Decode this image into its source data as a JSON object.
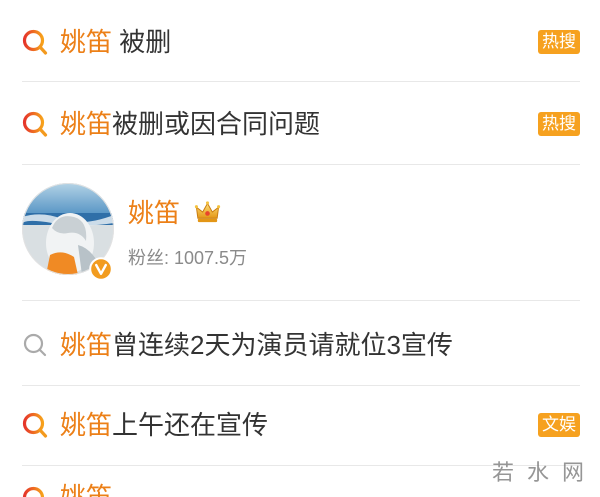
{
  "colors": {
    "keyword": "#ec8018",
    "text": "#333333",
    "muted": "#8a8a8a",
    "badge": "#f6a11f",
    "divider": "#e8e8e8",
    "verified": "#f29c1f"
  },
  "suggestions": [
    {
      "icon": "hot-search-icon",
      "keyword": "姚笛",
      "suffix": " 被删",
      "badge": "热搜"
    },
    {
      "icon": "hot-search-icon",
      "keyword": "姚笛",
      "suffix": "被删或因合同问题",
      "badge": "热搜"
    }
  ],
  "user": {
    "name": "姚笛",
    "fans": "粉丝: 1007.5万",
    "badge_icon": "crown-icon",
    "verified_icon": "verified-v-icon"
  },
  "more_suggestions": [
    {
      "icon": "search-icon",
      "keyword": "姚笛",
      "suffix": "曾连续2天为演员请就位3宣传"
    },
    {
      "icon": "hot-search-icon",
      "keyword": "姚笛",
      "suffix": "上午还在宣传",
      "badge": "文娱"
    },
    {
      "icon": "hot-search-icon",
      "keyword": "姚笛"
    }
  ],
  "watermark": "若水网"
}
